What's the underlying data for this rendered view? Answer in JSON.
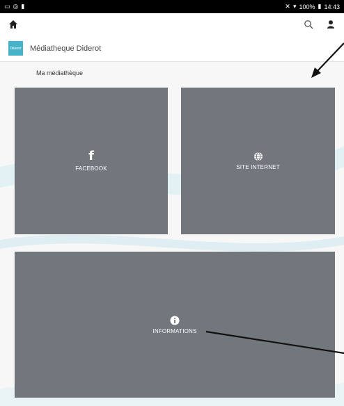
{
  "statusbar": {
    "left_icons": [
      "screen-icon",
      "location-icon",
      "battery-small-icon"
    ],
    "signal_text": "✕",
    "battery_text": "100%",
    "time": "14:43"
  },
  "toolbar": {
    "home_icon": "home-icon",
    "search_icon": "search-icon",
    "account_icon": "account-icon"
  },
  "library": {
    "logo_text": "Diderot",
    "name": "Médiatheque Diderot"
  },
  "section": {
    "title": "Ma médiathèque"
  },
  "tiles": [
    {
      "label": "FACEBOOK",
      "icon": "facebook-icon"
    },
    {
      "label": "SITE INTERNET",
      "icon": "globe-icon"
    },
    {
      "label": "INFORMATIONS",
      "icon": "info-icon"
    }
  ],
  "colors": {
    "tile_bg": "#72767d",
    "logo_bg": "#47b3c8",
    "statusbar_bg": "#000000"
  }
}
